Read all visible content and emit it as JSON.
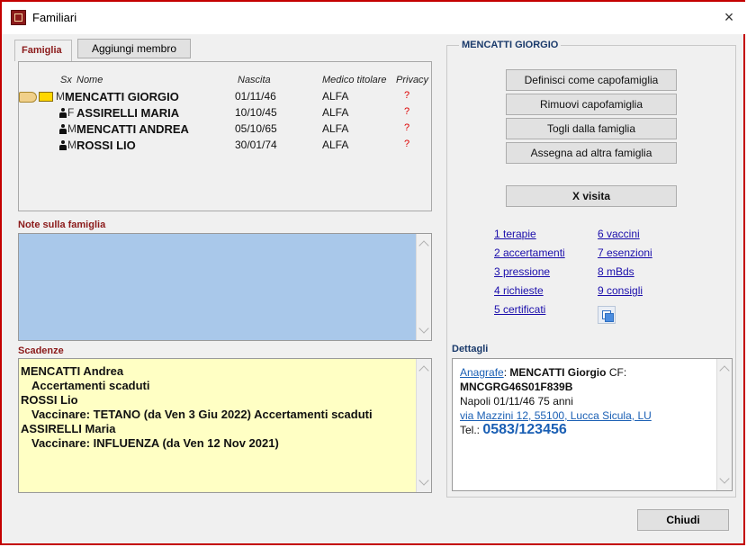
{
  "window": {
    "title": "Familiari",
    "close": "×"
  },
  "tabs": {
    "famiglia": "Famiglia",
    "add_member": "Aggiungi membro"
  },
  "members": {
    "headers": {
      "sx": "Sx",
      "nome": "Nome",
      "nascita": "Nascita",
      "medico": "Medico titolare",
      "privacy": "Privacy"
    },
    "rows": [
      {
        "sx": "M",
        "name": "MENCATTI GIORGIO",
        "birth": "01/11/46",
        "doctor": "ALFA",
        "privacy": "?"
      },
      {
        "sx": "F",
        "name": "ASSIRELLI MARIA",
        "birth": "10/10/45",
        "doctor": "ALFA",
        "privacy": "?"
      },
      {
        "sx": "M",
        "name": "MENCATTI ANDREA",
        "birth": "05/10/65",
        "doctor": "ALFA",
        "privacy": "?"
      },
      {
        "sx": "M",
        "name": "ROSSI LIO",
        "birth": "30/01/74",
        "doctor": "ALFA",
        "privacy": "?"
      }
    ]
  },
  "notes": {
    "label": "Note sulla famiglia"
  },
  "scadenze": {
    "label": "Scadenze",
    "lines": [
      "MENCATTI Andrea",
      "Accertamenti scaduti",
      "ROSSI Lio",
      "Vaccinare: TETANO (da Ven 3 Giu 2022)  Accertamenti scaduti",
      "ASSIRELLI Maria",
      "Vaccinare: INFLUENZA (da Ven 12 Nov 2021)"
    ]
  },
  "patient": {
    "name": "MENCATTI GIORGIO",
    "buttons": {
      "set_head": "Definisci come capofamiglia",
      "remove_head": "Rimuovi capofamiglia",
      "remove_from_family": "Togli dalla famiglia",
      "assign_other": "Assegna ad altra famiglia",
      "visit": "X visita"
    },
    "links": {
      "col1": [
        "1 terapie",
        "2 accertamenti",
        "3 pressione",
        "4 richieste",
        "5 certificati"
      ],
      "col2": [
        "6 vaccini",
        "7 esenzioni",
        "8 mBds",
        "9 consigli"
      ]
    }
  },
  "dettagli": {
    "label": "Dettagli",
    "anagrafe_link": "Anagrafe",
    "anagrafe_text": ": ",
    "name": "MENCATTI Giorgio",
    "cf_label": " CF:",
    "cf": "MNCGRG46S01F839B",
    "birth_line": "Napoli 01/11/46 75 anni",
    "address": "via Mazzini 12, 55100, Lucca Sicula, LU",
    "tel_label": "Tel.: ",
    "tel": "0583/123456"
  },
  "footer": {
    "close": "Chiudi"
  },
  "colors": {
    "accent_red": "#8b1a1a",
    "notes_bg": "#a9c8ea",
    "scadenze_bg": "#ffffc4",
    "link": "#1a0dab"
  }
}
